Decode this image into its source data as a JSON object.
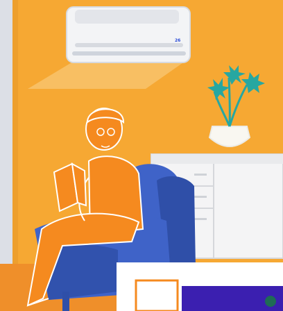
{
  "scene": {
    "description_free": true,
    "palette": {
      "wall": "#f6a833",
      "wall_light": "#f8b547",
      "wall_shadow": "#e88f22",
      "floor": "#ef8f2a",
      "left_strip": "#dcdfe6",
      "ac_body": "#f3f4f6",
      "ac_trim": "#d7dae0",
      "ac_led_blue": "#2a4bd6",
      "airflow": "#f9d28a",
      "person": "#f58a1f",
      "person_line": "#ffffff",
      "chair": "#3f63c8",
      "chair_dark": "#2f4fa8",
      "cabinet": "#f4f4f5",
      "cabinet_line": "#d5d7db",
      "plant": "#27a7a1",
      "vase": "#f9f7f1",
      "tv_frame": "#ffffff",
      "tv_screen": "#3b1fb0"
    },
    "icons": {
      "air_conditioner": "air-conditioner-icon",
      "plant": "potted-plant-icon",
      "book": "book-icon"
    },
    "ac_display_text": "26"
  }
}
